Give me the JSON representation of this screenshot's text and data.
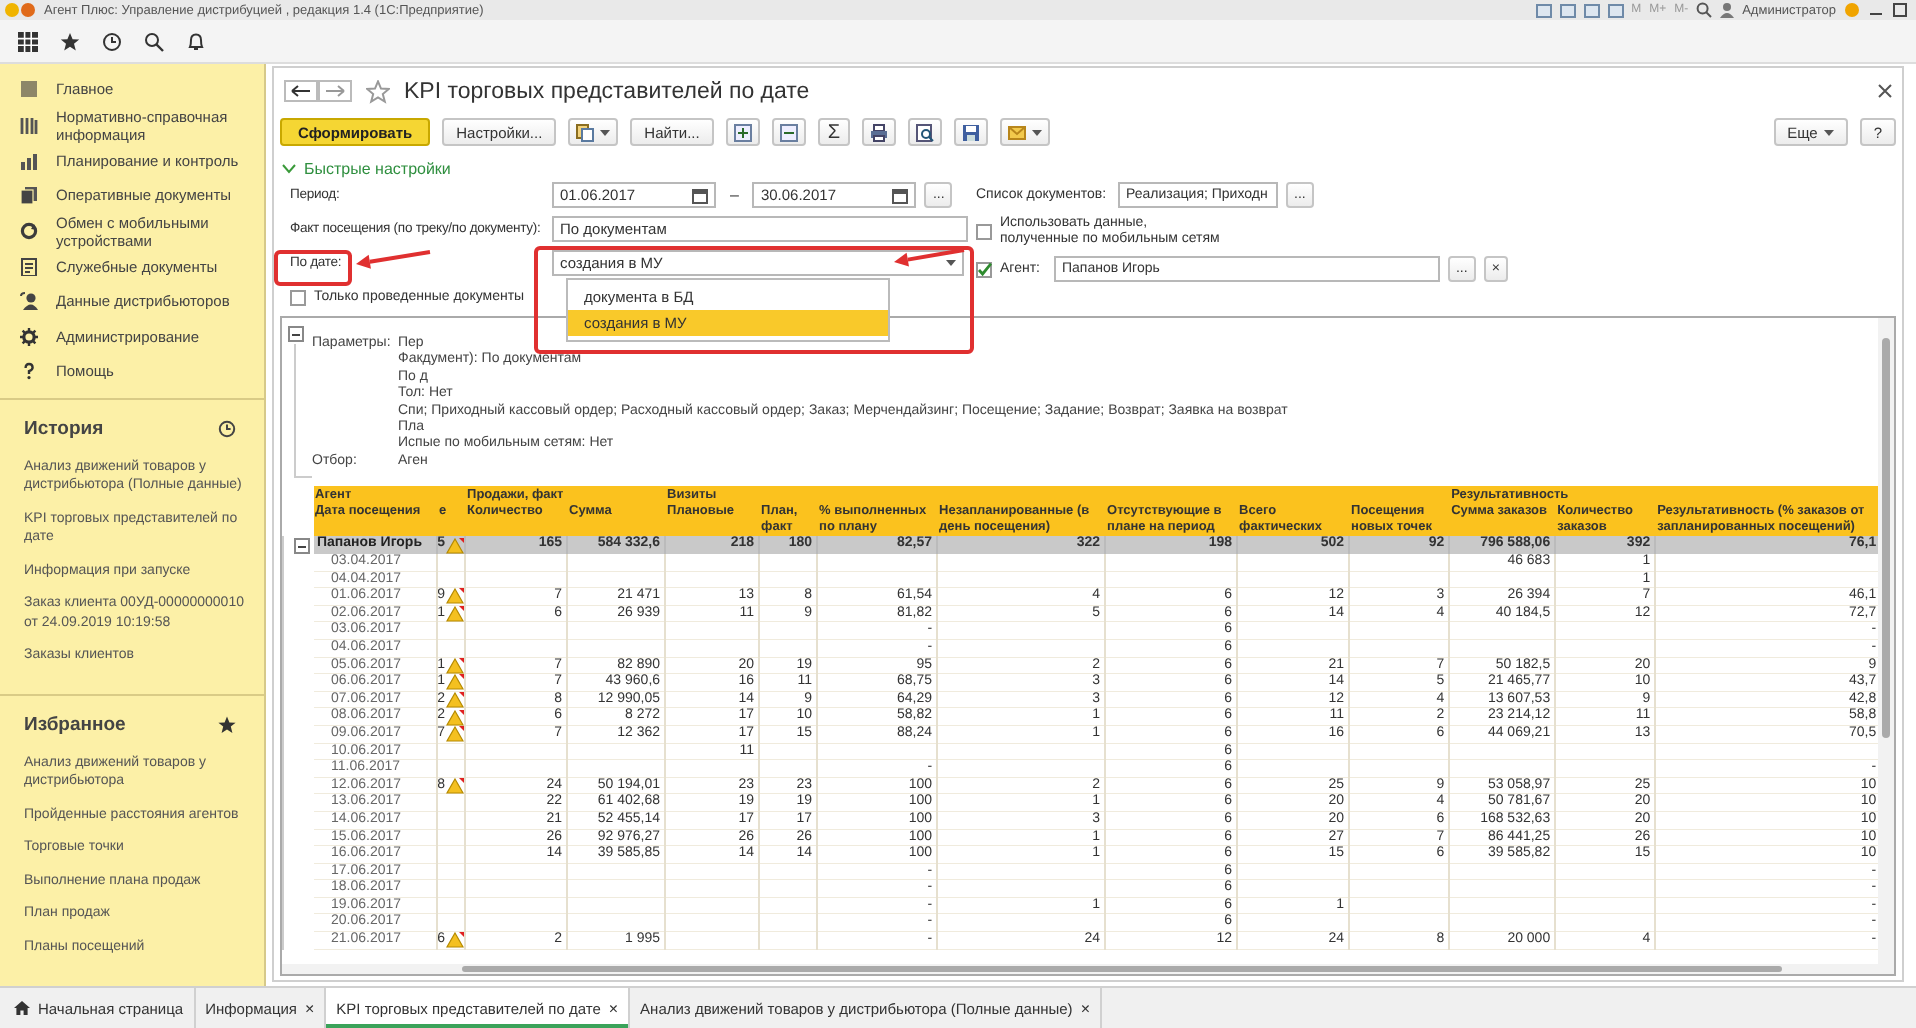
{
  "window": {
    "title": "Агент Плюс: Управление дистрибуцией , редакция 1.4 (1С:Предприятие)",
    "memory_buttons": [
      "M",
      "M+",
      "M-"
    ],
    "user": "Администратор"
  },
  "sidebar": {
    "nav": [
      {
        "kind": "home",
        "label": "Главное"
      },
      {
        "kind": "catalog",
        "label": "Нормативно-справочная информация"
      },
      {
        "kind": "planning",
        "label": "Планирование и контроль"
      },
      {
        "kind": "documents",
        "label": "Оперативные документы"
      },
      {
        "kind": "exchange",
        "label": "Обмен с мобильными устройствами"
      },
      {
        "kind": "service",
        "label": "Служебные документы"
      },
      {
        "kind": "distributors",
        "label": "Данные дистрибьюторов"
      },
      {
        "kind": "admin",
        "label": "Администрирование"
      },
      {
        "kind": "help",
        "label": "Помощь"
      }
    ],
    "history": {
      "title": "История",
      "items": [
        "Анализ движений товаров у дистрибьютора (Полные данные)",
        "KPI торговых представителей по дате",
        "Информация при запуске",
        "Заказ клиента 00УД-00000000010 от 24.09.2019 10:19:58",
        "Заказы клиентов"
      ]
    },
    "favorites": {
      "title": "Избранное",
      "items": [
        "Анализ движений товаров у дистрибьютора",
        "Пройденные расстояния агентов",
        "Торговые точки",
        "Выполнение плана продаж",
        "План продаж",
        "Планы посещений"
      ]
    }
  },
  "form": {
    "title": "KPI торговых представителей по дате",
    "toolbar": [
      {
        "kind": "primary",
        "label": "Сформировать"
      },
      {
        "kind": "text",
        "label": "Настройки..."
      },
      {
        "kind": "copy-menu"
      },
      {
        "kind": "text",
        "label": "Найти..."
      },
      {
        "kind": "expand"
      },
      {
        "kind": "collapse"
      },
      {
        "kind": "glyph",
        "label": "Σ"
      },
      {
        "kind": "print"
      },
      {
        "kind": "preview"
      },
      {
        "kind": "save"
      },
      {
        "kind": "mail-menu"
      }
    ],
    "more_button": "Еще",
    "help_button": "?",
    "quick_settings": "Быстрые настройки",
    "period": {
      "label": "Период:",
      "from": "01.06.2017",
      "dash": "–",
      "to": "30.06.2017",
      "button": "..."
    },
    "visit_fact": {
      "label": "Факт посещения (по треку/по документу):",
      "value": "По документам"
    },
    "by_date": {
      "label": "По дате:",
      "value": "создания в МУ",
      "options": [
        {
          "label": "документа в БД",
          "selected": false
        },
        {
          "label": "создания в МУ",
          "selected": true
        }
      ]
    },
    "posted_only": {
      "label": "Только проведенные документы",
      "checked": false
    },
    "doc_list": {
      "label": "Список документов:",
      "value": "Реализация; Приходн",
      "button": "..."
    },
    "use_mobile": {
      "label": "Использовать данные,\nполученные по мобильным сетям",
      "checked": false
    },
    "agent": {
      "label": "Агент:",
      "value": "Папанов Игорь",
      "checked": true,
      "button": "...",
      "clear": "×"
    }
  },
  "report": {
    "parameters": {
      "label": "Параметры:",
      "lines": [
        "Пер",
        "Факдумент): По документам",
        "По д",
        "Тол: Нет",
        "Спи; Приходный кассовый ордер; Расходный кассовый ордер; Заказ; Мерчендайзинг; Посещение; Задание; Возврат; Заявка на возврат",
        "Пла",
        "Испые по мобильным сетям: Нет"
      ]
    },
    "filter": {
      "label": "Отбор:",
      "value": "Аген"
    },
    "column_groups": [
      {
        "label": "Агент",
        "columns": [
          {
            "label": "Дата посещения"
          },
          {
            "label": "е"
          }
        ]
      },
      {
        "label": "Продажи, факт",
        "columns": [
          {
            "label": "Количество"
          },
          {
            "label": "Сумма"
          }
        ]
      },
      {
        "label": "Визиты",
        "columns": [
          {
            "label": "Плановые"
          },
          {
            "label": "План, факт"
          },
          {
            "label": "% выполненных по плану"
          },
          {
            "label": "Незапланированные (в день посещения)"
          },
          {
            "label": "Отсутствующие в плане на период"
          },
          {
            "label": "Всего фактических"
          },
          {
            "label": "Посещения новых точек"
          }
        ]
      },
      {
        "label": "Результативность",
        "columns": [
          {
            "label": "Сумма заказов"
          },
          {
            "label": "Количество заказов"
          },
          {
            "label": "Результативность (% заказов от запланированных посещений)"
          }
        ]
      }
    ],
    "rows": [
      {
        "kind": "total",
        "warning": true,
        "cells": [
          "Папанов Игорь",
          "5",
          "165",
          "584 332,6",
          "218",
          "180",
          "82,57",
          "322",
          "198",
          "502",
          "92",
          "796 588,06",
          "392",
          "76,1"
        ]
      },
      {
        "kind": "day",
        "warning": false,
        "cells": [
          "03.04.2017",
          null,
          null,
          null,
          null,
          null,
          null,
          null,
          null,
          null,
          null,
          "46 683",
          "1",
          null
        ]
      },
      {
        "kind": "day",
        "warning": false,
        "cells": [
          "04.04.2017",
          null,
          null,
          null,
          null,
          null,
          null,
          null,
          null,
          null,
          null,
          null,
          "1",
          null
        ]
      },
      {
        "kind": "day",
        "warning": true,
        "cells": [
          "01.06.2017",
          "9",
          "7",
          "21 471",
          "13",
          "8",
          "61,54",
          "4",
          "6",
          "12",
          "3",
          "26 394",
          "7",
          "46,1"
        ]
      },
      {
        "kind": "day",
        "warning": true,
        "cells": [
          "02.06.2017",
          "1",
          "6",
          "26 939",
          "11",
          "9",
          "81,82",
          "5",
          "6",
          "14",
          "4",
          "40 184,5",
          "12",
          "72,7"
        ]
      },
      {
        "kind": "day",
        "warning": false,
        "cells": [
          "03.06.2017",
          null,
          null,
          null,
          null,
          null,
          "-",
          null,
          "6",
          null,
          null,
          null,
          null,
          "-"
        ]
      },
      {
        "kind": "day",
        "warning": false,
        "cells": [
          "04.06.2017",
          null,
          null,
          null,
          null,
          null,
          "-",
          null,
          "6",
          null,
          null,
          null,
          null,
          "-"
        ]
      },
      {
        "kind": "day",
        "warning": true,
        "cells": [
          "05.06.2017",
          "1",
          "7",
          "82 890",
          "20",
          "19",
          "95",
          "2",
          "6",
          "21",
          "7",
          "50 182,5",
          "20",
          "9"
        ]
      },
      {
        "kind": "day",
        "warning": true,
        "cells": [
          "06.06.2017",
          "1",
          "7",
          "43 960,6",
          "16",
          "11",
          "68,75",
          "3",
          "6",
          "14",
          "5",
          "21 465,77",
          "10",
          "43,7"
        ]
      },
      {
        "kind": "day",
        "warning": true,
        "cells": [
          "07.06.2017",
          "2",
          "8",
          "12 990,05",
          "14",
          "9",
          "64,29",
          "3",
          "6",
          "12",
          "4",
          "13 607,53",
          "9",
          "42,8"
        ]
      },
      {
        "kind": "day",
        "warning": true,
        "cells": [
          "08.06.2017",
          "2",
          "6",
          "8 272",
          "17",
          "10",
          "58,82",
          "1",
          "6",
          "11",
          "2",
          "23 214,12",
          "11",
          "58,8"
        ]
      },
      {
        "kind": "day",
        "warning": true,
        "cells": [
          "09.06.2017",
          "7",
          "7",
          "12 362",
          "17",
          "15",
          "88,24",
          "1",
          "6",
          "16",
          "6",
          "44 069,21",
          "13",
          "70,5"
        ]
      },
      {
        "kind": "day",
        "warning": false,
        "cells": [
          "10.06.2017",
          null,
          null,
          null,
          "11",
          null,
          null,
          null,
          "6",
          null,
          null,
          null,
          null,
          null
        ]
      },
      {
        "kind": "day",
        "warning": false,
        "cells": [
          "11.06.2017",
          null,
          null,
          null,
          null,
          null,
          "-",
          null,
          "6",
          null,
          null,
          null,
          null,
          "-"
        ]
      },
      {
        "kind": "day",
        "warning": true,
        "cells": [
          "12.06.2017",
          "8",
          "24",
          "50 194,01",
          "23",
          "23",
          "100",
          "2",
          "6",
          "25",
          "9",
          "53 058,97",
          "25",
          "10"
        ]
      },
      {
        "kind": "day",
        "warning": false,
        "cells": [
          "13.06.2017",
          null,
          "22",
          "61 402,68",
          "19",
          "19",
          "100",
          "1",
          "6",
          "20",
          "4",
          "50 781,67",
          "20",
          "10"
        ]
      },
      {
        "kind": "day",
        "warning": false,
        "cells": [
          "14.06.2017",
          null,
          "21",
          "52 455,14",
          "17",
          "17",
          "100",
          "3",
          "6",
          "20",
          "6",
          "168 532,63",
          "20",
          "10"
        ]
      },
      {
        "kind": "day",
        "warning": false,
        "cells": [
          "15.06.2017",
          null,
          "26",
          "92 976,27",
          "26",
          "26",
          "100",
          "1",
          "6",
          "27",
          "7",
          "86 441,25",
          "26",
          "10"
        ]
      },
      {
        "kind": "day",
        "warning": false,
        "cells": [
          "16.06.2017",
          null,
          "14",
          "39 585,85",
          "14",
          "14",
          "100",
          "1",
          "6",
          "15",
          "6",
          "39 585,82",
          "15",
          "10"
        ]
      },
      {
        "kind": "day",
        "warning": false,
        "cells": [
          "17.06.2017",
          null,
          null,
          null,
          null,
          null,
          "-",
          null,
          "6",
          null,
          null,
          null,
          null,
          "-"
        ]
      },
      {
        "kind": "day",
        "warning": false,
        "cells": [
          "18.06.2017",
          null,
          null,
          null,
          null,
          null,
          "-",
          null,
          "6",
          null,
          null,
          null,
          null,
          "-"
        ]
      },
      {
        "kind": "day",
        "warning": false,
        "cells": [
          "19.06.2017",
          null,
          null,
          null,
          null,
          null,
          "-",
          "1",
          "6",
          "1",
          null,
          null,
          null,
          "-"
        ]
      },
      {
        "kind": "day",
        "warning": false,
        "cells": [
          "20.06.2017",
          null,
          null,
          null,
          null,
          null,
          "-",
          null,
          "6",
          null,
          null,
          null,
          null,
          "-"
        ]
      },
      {
        "kind": "day",
        "warning": true,
        "cells": [
          "21.06.2017",
          "6",
          "2",
          "1 995",
          null,
          null,
          "-",
          "24",
          "12",
          "24",
          "8",
          "20 000",
          "4",
          "-"
        ]
      }
    ]
  },
  "annotations": [
    {
      "kind": "box"
    },
    {
      "kind": "box"
    },
    {
      "kind": "arrow"
    },
    {
      "kind": "arrow"
    }
  ],
  "tabs": [
    {
      "kind": "home",
      "label": "Начальная страница",
      "selected": false
    },
    {
      "label": "Информация",
      "selected": false,
      "close": "×"
    },
    {
      "label": "KPI торговых представителей по дате",
      "selected": true,
      "close": "×"
    },
    {
      "label": "Анализ движений товаров у дистрибьютора (Полные данные)",
      "selected": false,
      "close": "×"
    }
  ]
}
